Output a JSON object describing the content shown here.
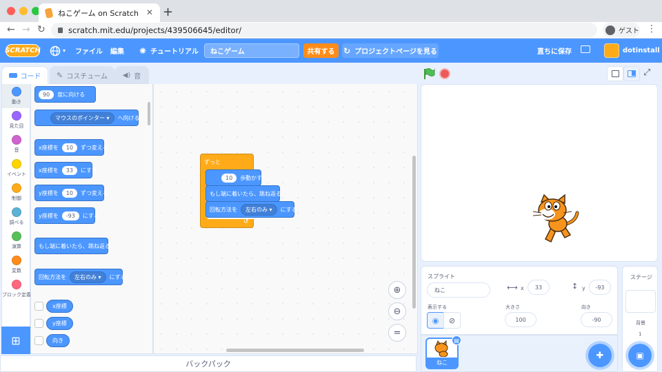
{
  "browser": {
    "tab_title": "ねこゲーム on Scratch",
    "url": "scratch.mit.edu/projects/439506645/editor/",
    "profile_label": "ゲスト"
  },
  "menu": {
    "logo": "SCRATCH",
    "file": "ファイル",
    "edit": "編集",
    "tutorial": "チュートリアル",
    "project_title": "ねこゲーム",
    "share": "共有する",
    "project_page": "プロジェクトページを見る",
    "save_now": "直ちに保存",
    "username": "dotinstall"
  },
  "editor_tabs": {
    "code": "コード",
    "costume": "コスチューム",
    "sound": "音"
  },
  "categories": [
    {
      "label": "動き",
      "color": "#4c97ff"
    },
    {
      "label": "見た目",
      "color": "#9966ff"
    },
    {
      "label": "音",
      "color": "#cf63cf"
    },
    {
      "label": "イベント",
      "color": "#ffd500"
    },
    {
      "label": "制御",
      "color": "#ffab19"
    },
    {
      "label": "調べる",
      "color": "#5cb1d6"
    },
    {
      "label": "演算",
      "color": "#59c059"
    },
    {
      "label": "変数",
      "color": "#ff8c1a"
    },
    {
      "label": "ブロック定義",
      "color": "#ff6680"
    }
  ],
  "palette": {
    "turn_deg_value": "90",
    "turn_deg_label": "度に向ける",
    "point_towards_option": "マウスのポインター",
    "point_towards_label": "へ向ける",
    "change_x_label": "x座標を",
    "change_x_value": "10",
    "change_x_suffix": "ずつ変える",
    "set_x_label": "x座標を",
    "set_x_value": "33",
    "set_x_suffix": "にする",
    "change_y_label": "y座標を",
    "change_y_value": "10",
    "change_y_suffix": "ずつ変える",
    "set_y_label": "y座標を",
    "set_y_value": "-93",
    "set_y_suffix": "にする",
    "bounce_label": "もし端に着いたら、跳ね返る",
    "rotation_label": "回転方法を",
    "rotation_option": "左右のみ",
    "rotation_suffix": "にする",
    "reporter_x": "x座標",
    "reporter_y": "y座標",
    "reporter_dir": "向き"
  },
  "script": {
    "forever_label": "ずっと",
    "move_value": "10",
    "move_label": "歩動かす",
    "bounce_label": "もし端に着いたら、跳ね返る",
    "rotation_label": "回転方法を",
    "rotation_option": "左右のみ",
    "rotation_suffix": "にする"
  },
  "zoom": {
    "reset_symbol": "="
  },
  "backpack_label": "バックパック",
  "sprite_info": {
    "header": "スプライト",
    "name": "ねこ",
    "x_label": "x",
    "x_value": "33",
    "y_label": "y",
    "y_value": "-93",
    "show_label": "表示する",
    "size_label": "大きさ",
    "size_value": "100",
    "direction_label": "向き",
    "direction_value": "-90"
  },
  "sprite_tile_name": "ねこ",
  "stage_panel": {
    "header": "ステージ",
    "backdrop_label": "背景",
    "backdrop_count": "1"
  }
}
